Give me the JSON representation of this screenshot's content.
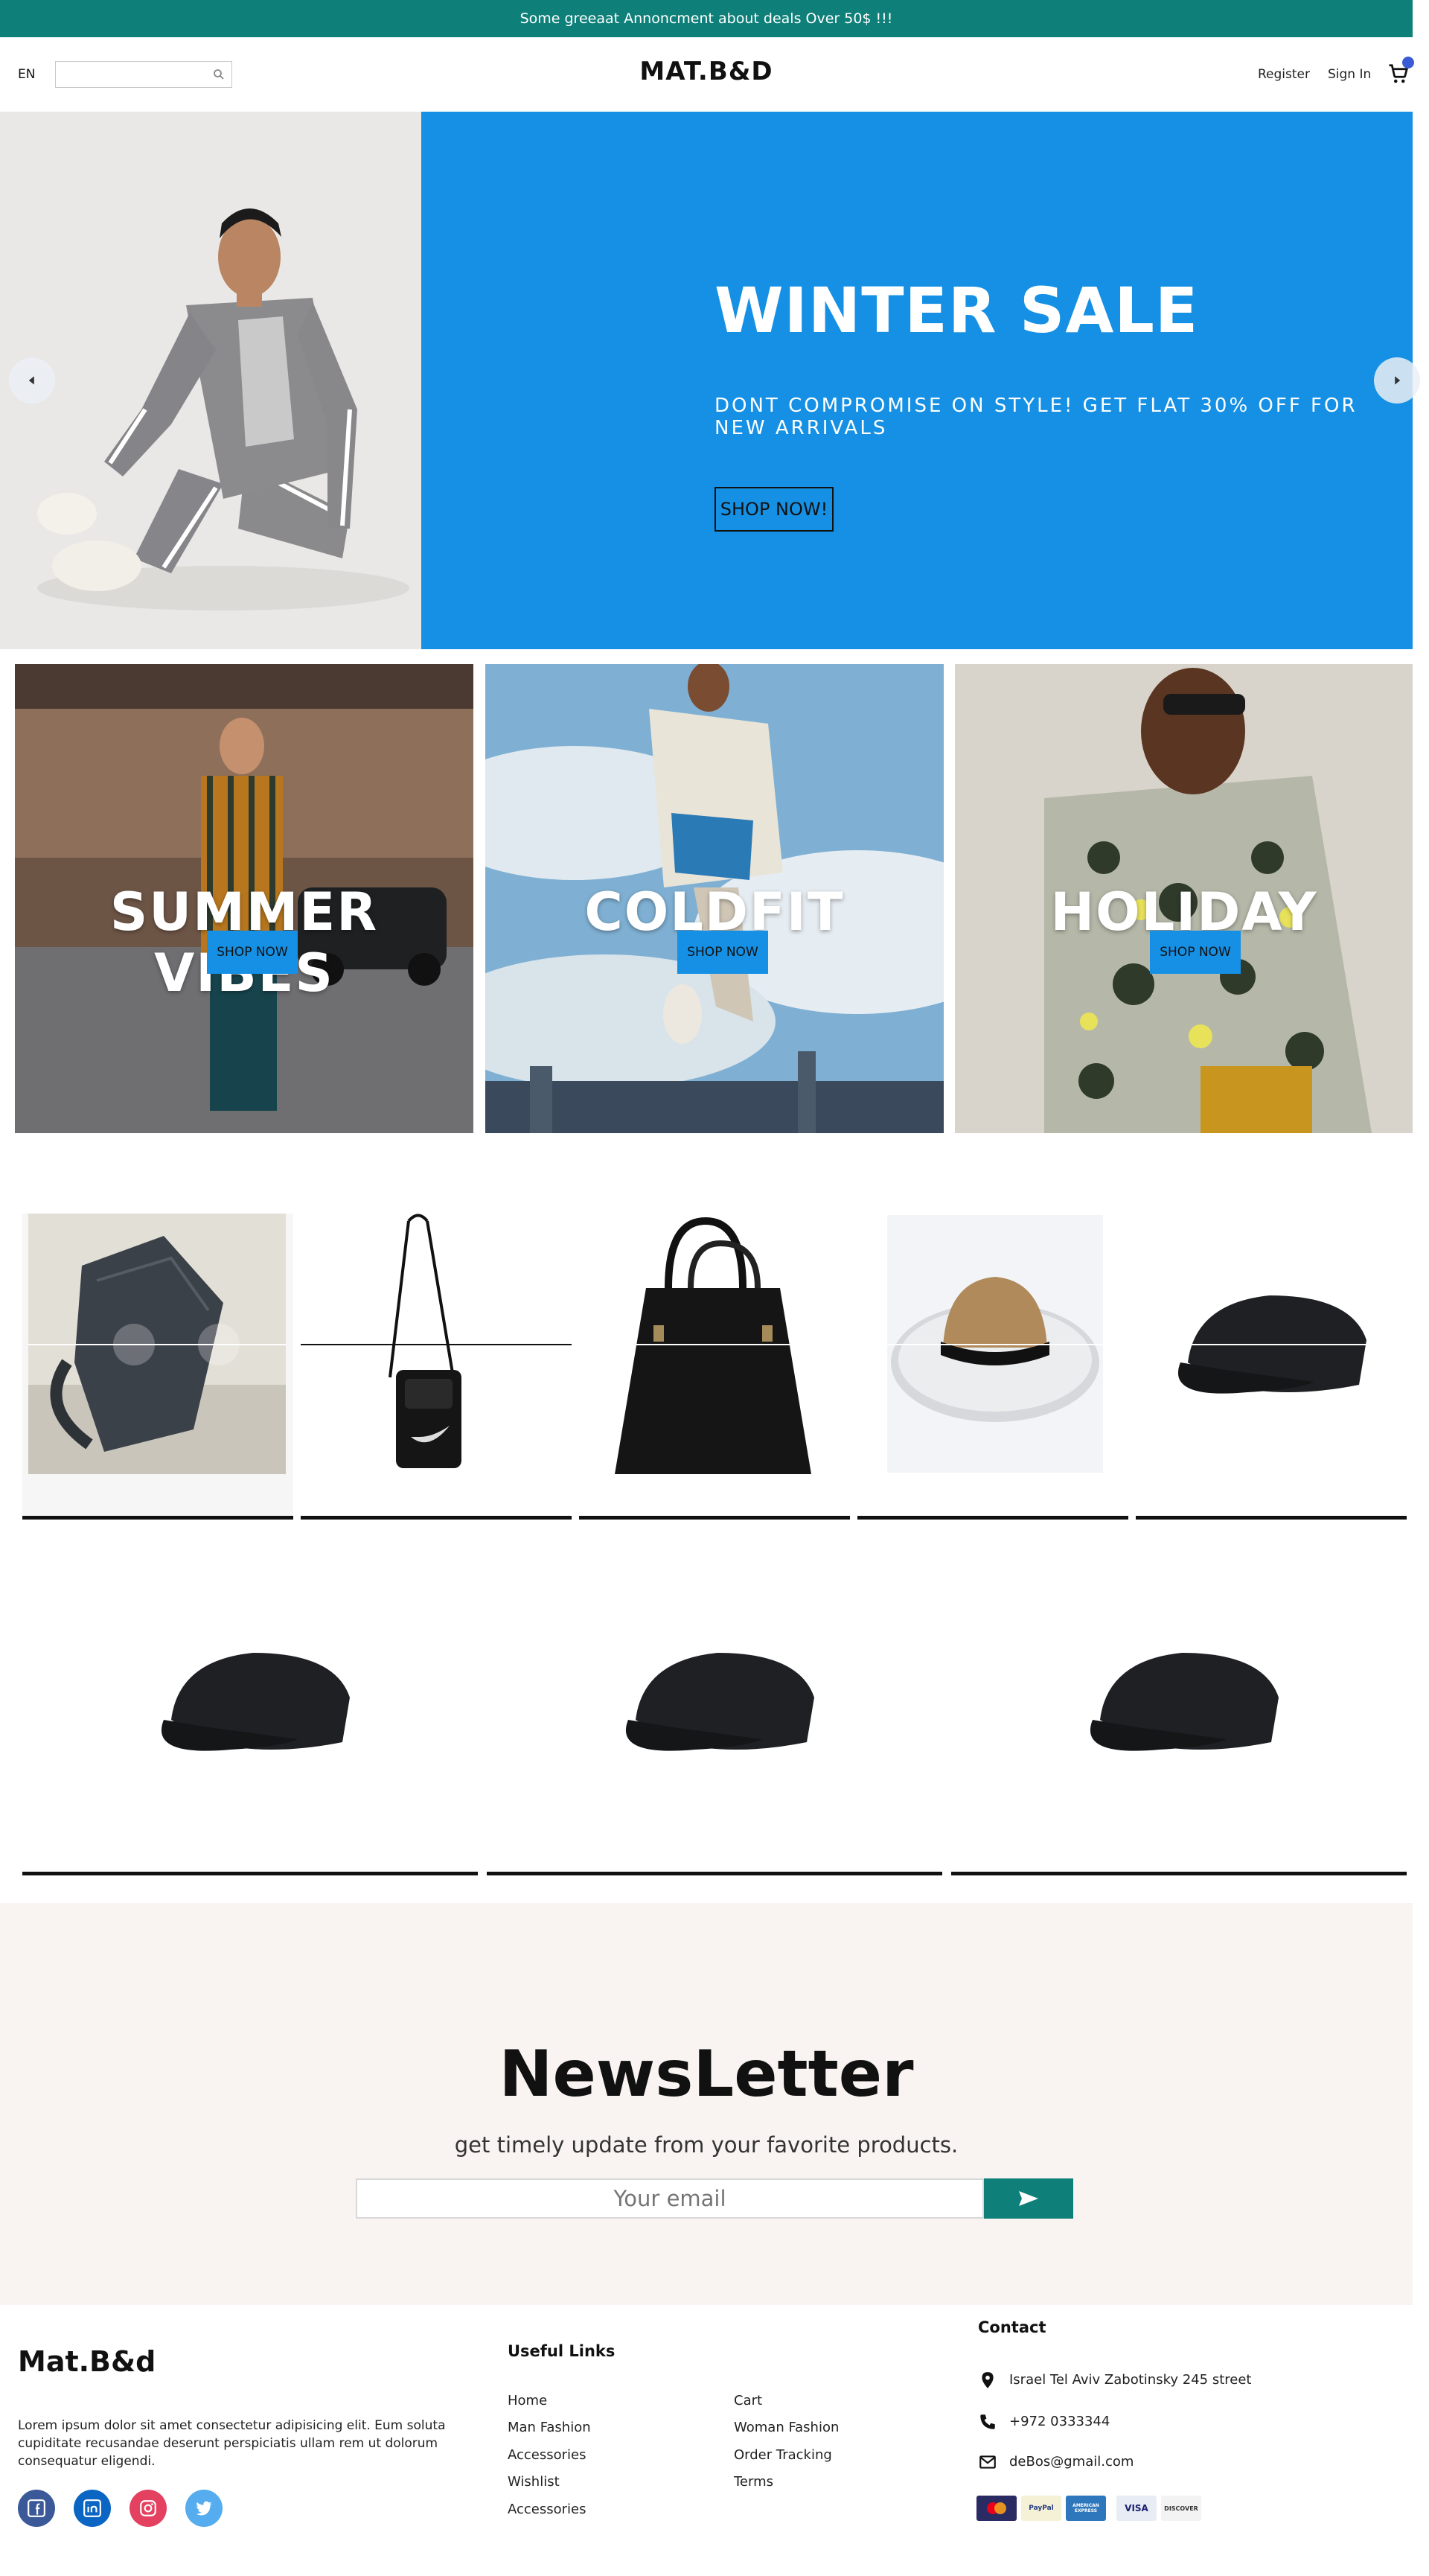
{
  "announcement": "Some greeaat Annoncment about deals Over 50$ !!!",
  "header": {
    "lang": "EN",
    "search_placeholder": "",
    "logo": "MAT.B&D",
    "register": "Register",
    "sign_in": "Sign In"
  },
  "hero": {
    "title": "WINTER SALE",
    "subtitle": "DONT COMPROMISE ON STYLE! GET FLAT 30% OFF FOR NEW ARRIVALS",
    "button": "SHOP NOW!"
  },
  "categories": [
    {
      "title": "SUMMER VIBES",
      "button": "SHOP NOW"
    },
    {
      "title": "COLDFIT",
      "button": "SHOP NOW"
    },
    {
      "title": "HOLIDAY",
      "button": "SHOP NOW"
    }
  ],
  "newsletter": {
    "title": "NewsLetter",
    "subtitle": "get timely update from your favorite products.",
    "placeholder": "Your email"
  },
  "footer": {
    "brand": "Mat.B&d",
    "description": "Lorem ipsum dolor sit amet consectetur adipisicing elit. Eum soluta cupiditate recusandae deserunt perspiciatis ullam rem ut dolorum consequatur eligendi.",
    "useful_links_title": "Useful Links",
    "links_col1": [
      "Home",
      "Man Fashion",
      "Accessories",
      "Wishlist",
      "Accessories"
    ],
    "links_col2": [
      "Cart",
      "Woman Fashion",
      "Order Tracking",
      "Terms"
    ],
    "contact_title": "Contact",
    "address": "Israel Tel Aviv Zabotinsky 245 street",
    "phone": "+972 0333344",
    "email": "deBos@gmail.com",
    "payment_cards": [
      "MasterCard",
      "PayPal",
      "AMERICAN EXPRESS",
      "VISA",
      "DISCOVER"
    ]
  },
  "colors": {
    "teal": "#0f8079",
    "blue": "#1590e4",
    "newsletter_bg": "#f9f3f1"
  }
}
